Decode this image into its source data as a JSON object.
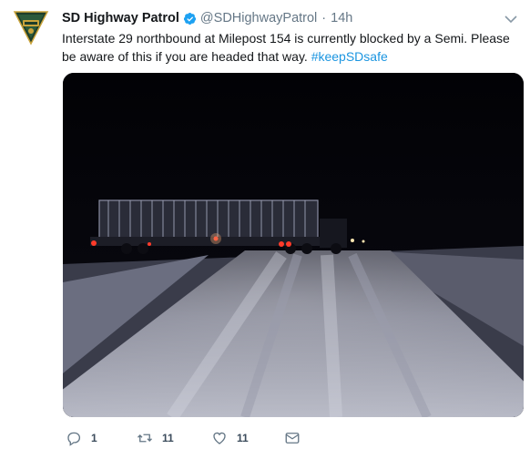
{
  "tweet": {
    "author_name": "SD Highway Patrol",
    "handle": "@SDHighwayPatrol",
    "separator": "·",
    "time": "14h",
    "text_main": "Interstate 29 northbound at Milepost 154  is currently blocked  by a Semi. Please be aware of this if you are headed that way. ",
    "hashtag": "#keepSDsafe",
    "avatar_badge_text": "SOUTH DAKOTA HIGHWAY PATROL",
    "media_description_icon": "photo-night-highway-semi"
  },
  "actions": {
    "reply_count": "1",
    "retweet_count": "11",
    "like_count": "11"
  },
  "colors": {
    "accent": "#1b95e0",
    "secondary_text": "#657786",
    "badge_green": "#1e3d2a",
    "badge_gold": "#c9a33b"
  }
}
